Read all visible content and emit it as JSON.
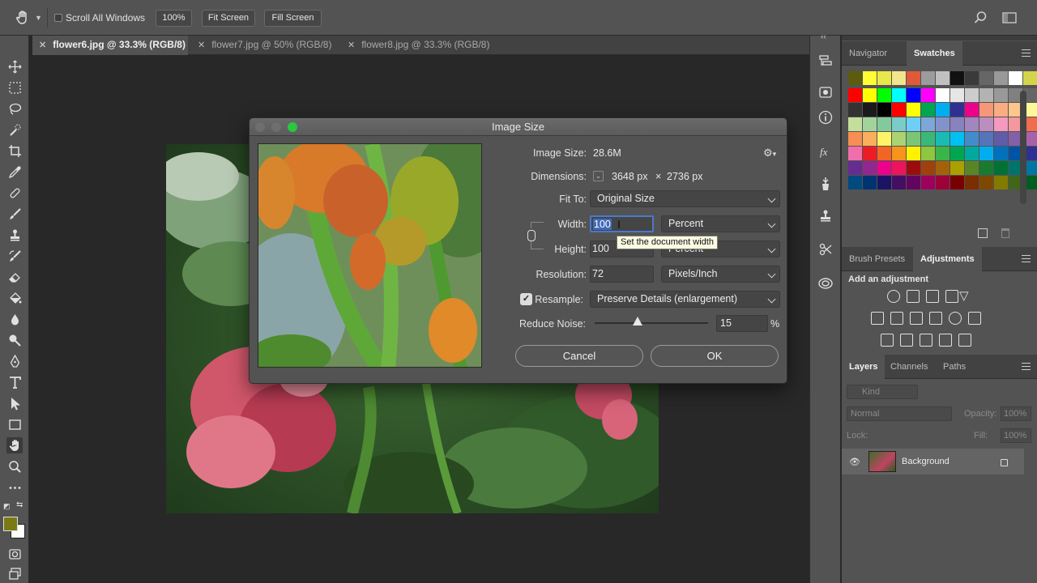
{
  "options_bar": {
    "scroll_all_label": "Scroll All Windows",
    "zoom_button": "100%",
    "fit_screen_button": "Fit Screen",
    "fill_screen_button": "Fill Screen"
  },
  "tabs": [
    {
      "label": "flower6.jpg @ 33.3% (RGB/8)",
      "active": true
    },
    {
      "label": "flower7.jpg @ 50% (RGB/8)",
      "active": false
    },
    {
      "label": "flower8.jpg @ 33.3% (RGB/8)",
      "active": false
    }
  ],
  "panels": {
    "top": {
      "tab1": "Navigator",
      "tab2": "Swatches"
    },
    "middle": {
      "tab1": "Brush Presets",
      "tab2": "Adjustments",
      "add_adjustment": "Add an adjustment"
    },
    "layers": {
      "tab1": "Layers",
      "tab2": "Channels",
      "tab3": "Paths",
      "kind": "Kind",
      "blend_mode": "Normal",
      "opacity_label": "Opacity:",
      "opacity_value": "100%",
      "lock_label": "Lock:",
      "fill_label": "Fill:",
      "fill_value": "100%",
      "layer_name": "Background"
    }
  },
  "dialog": {
    "title": "Image Size",
    "image_size_label": "Image Size:",
    "image_size_value": "28.6M",
    "dimensions_label": "Dimensions:",
    "dimensions_width": "3648 px",
    "dimensions_x": "×",
    "dimensions_height": "2736 px",
    "fit_to_label": "Fit To:",
    "fit_to_value": "Original Size",
    "width_label": "Width:",
    "width_value": "100",
    "width_unit": "Percent",
    "height_label": "Height:",
    "height_value": "100",
    "height_unit": "Percent",
    "resolution_label": "Resolution:",
    "resolution_value": "72",
    "resolution_unit": "Pixels/Inch",
    "resample_label": "Resample:",
    "resample_checked": true,
    "resample_value": "Preserve Details (enlargement)",
    "reduce_noise_label": "Reduce Noise:",
    "reduce_noise_value": "15",
    "reduce_noise_unit": "%",
    "reduce_noise_fraction": 0.38,
    "cancel_button": "Cancel",
    "ok_button": "OK",
    "tooltip": "Set the document width"
  },
  "colors": {
    "foreground": "#7a7a14",
    "background": "#ffffff",
    "accent_selection": "#3f6bb8"
  }
}
